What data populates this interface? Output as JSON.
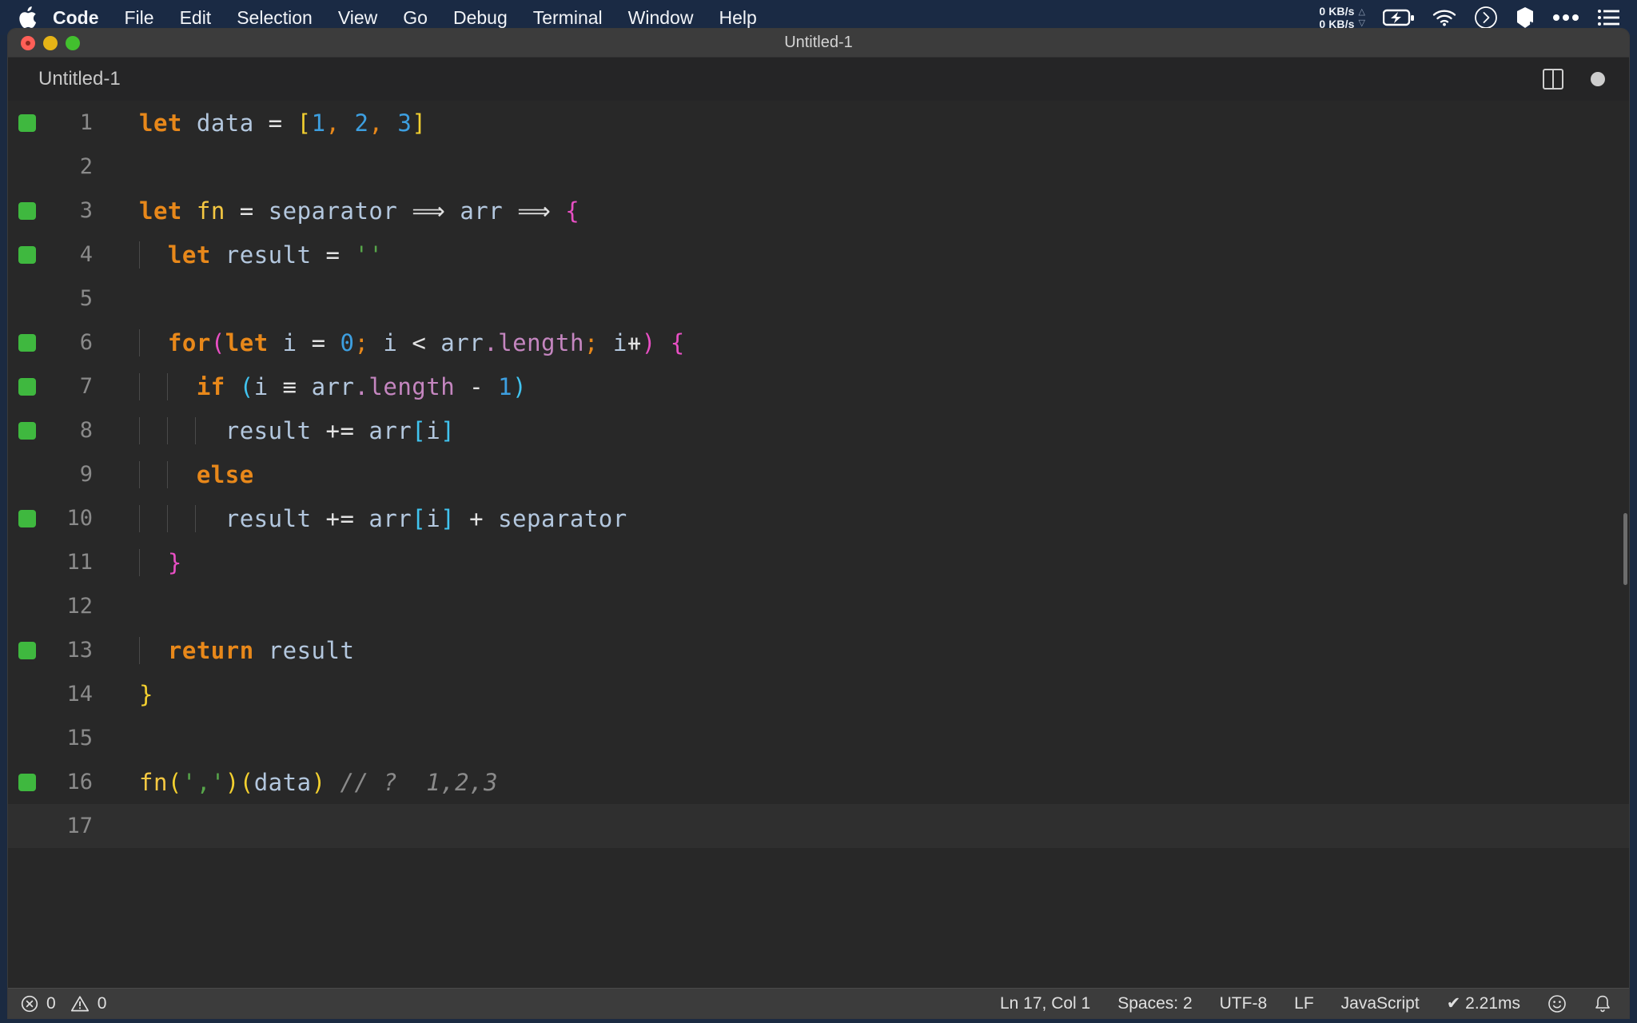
{
  "menubar": {
    "apple_icon": "apple-logo-icon",
    "items": [
      {
        "label": "Code",
        "bold": true
      },
      {
        "label": "File",
        "bold": false
      },
      {
        "label": "Edit",
        "bold": false
      },
      {
        "label": "Selection",
        "bold": false
      },
      {
        "label": "View",
        "bold": false
      },
      {
        "label": "Go",
        "bold": false
      },
      {
        "label": "Debug",
        "bold": false
      },
      {
        "label": "Terminal",
        "bold": false
      },
      {
        "label": "Window",
        "bold": false
      },
      {
        "label": "Help",
        "bold": false
      }
    ],
    "tray": {
      "net_up": "0 KB/s",
      "net_down": "0 KB/s",
      "up_arrow": "△",
      "down_arrow": "▽",
      "icons": [
        "battery-charging-icon",
        "wifi-icon",
        "chevron-right-circle-icon",
        "cube-icon",
        "ellipsis-icon",
        "list-icon"
      ]
    },
    "background": "#1a2a44"
  },
  "window": {
    "title": "Untitled-1",
    "traffic": {
      "close": "close-button",
      "minimize": "minimize-button",
      "maximize": "maximize-button"
    }
  },
  "tabbar": {
    "tab_label": "Untitled-1",
    "split_icon": "split-editor-icon",
    "unsaved_icon": "unsaved-dot-icon"
  },
  "editor": {
    "language": "javascript",
    "cursor_line": 17,
    "lines": [
      {
        "n": "1",
        "mark": true,
        "indent": 0
      },
      {
        "n": "2",
        "mark": false,
        "indent": 0
      },
      {
        "n": "3",
        "mark": true,
        "indent": 0
      },
      {
        "n": "4",
        "mark": true,
        "indent": 1
      },
      {
        "n": "5",
        "mark": false,
        "indent": 1
      },
      {
        "n": "6",
        "mark": true,
        "indent": 1
      },
      {
        "n": "7",
        "mark": true,
        "indent": 2
      },
      {
        "n": "8",
        "mark": true,
        "indent": 3
      },
      {
        "n": "9",
        "mark": false,
        "indent": 2
      },
      {
        "n": "10",
        "mark": true,
        "indent": 3
      },
      {
        "n": "11",
        "mark": false,
        "indent": 1
      },
      {
        "n": "12",
        "mark": false,
        "indent": 1
      },
      {
        "n": "13",
        "mark": true,
        "indent": 1
      },
      {
        "n": "14",
        "mark": false,
        "indent": 0
      },
      {
        "n": "15",
        "mark": false,
        "indent": 0
      },
      {
        "n": "16",
        "mark": true,
        "indent": 0
      },
      {
        "n": "17",
        "mark": false,
        "indent": 0
      }
    ],
    "source_text": [
      "let data = [1, 2, 3]",
      "",
      "let fn = separator => arr => {",
      "  let result = ''",
      "",
      "  for(let i = 0; i < arr.length; i++) {",
      "    if (i === arr.length - 1)",
      "      result += arr[i]",
      "    else",
      "      result += arr[i] + separator",
      "  }",
      "",
      "  return result",
      "}",
      "",
      "fn(',')(data) // ?  1,2,3",
      ""
    ],
    "colors": {
      "background": "#282828",
      "keyword": "#e8881a",
      "identifier": "#b3c7de",
      "function": "#f5c842",
      "number": "#3d9fe0",
      "string": "#57a64a",
      "property": "#c586c0",
      "bracket_yellow": "#f3d02f",
      "bracket_magenta": "#e84fc4",
      "bracket_cyan": "#41c4f0",
      "comment": "#8a8a8a",
      "gutter_mark": "#3fb83f",
      "line_number": "#8a8a8a"
    }
  },
  "statusbar": {
    "errors_icon": "error-circle-icon",
    "errors": "0",
    "warnings_icon": "warning-triangle-icon",
    "warnings": "0",
    "position": "Ln 17, Col 1",
    "indentation": "Spaces: 2",
    "encoding": "UTF-8",
    "eol": "LF",
    "language": "JavaScript",
    "timing": "✔ 2.21ms",
    "feedback_icon": "smiley-icon",
    "notifications_icon": "bell-icon"
  }
}
